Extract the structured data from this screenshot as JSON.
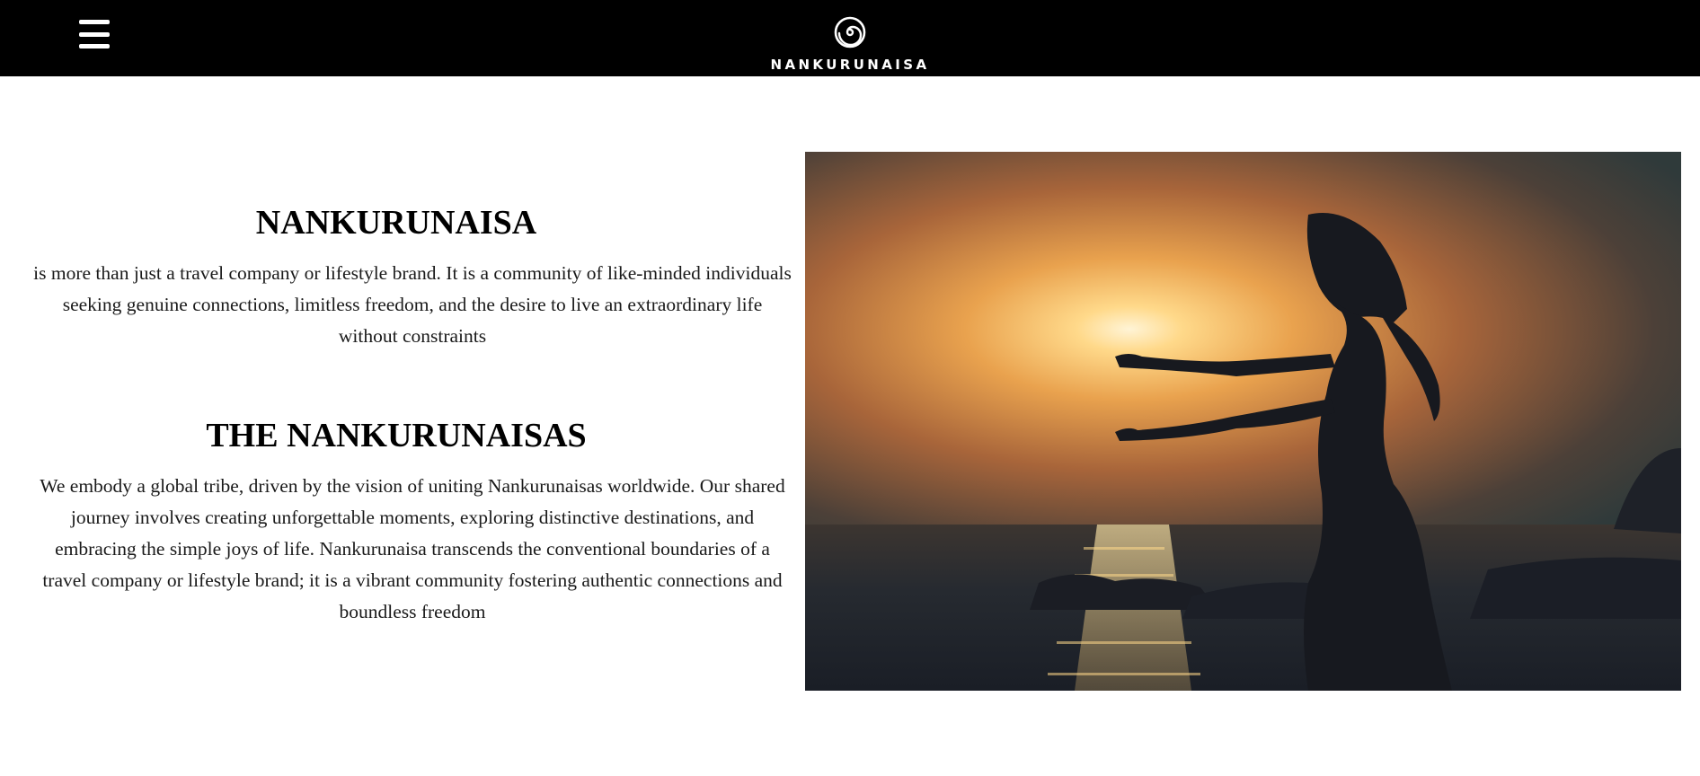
{
  "header": {
    "menu_icon": "hamburger-menu-icon",
    "logo_icon": "spiral-icon",
    "logo_text": "NANKURUNAISA",
    "background": "#000000"
  },
  "intro": {
    "title": "NANKURUNAISA",
    "body": "is more than just a travel company or lifestyle brand. It is a community of like-minded individuals seeking genuine connections, limitless freedom, and the desire to live an extraordinary life without constraints"
  },
  "tribe": {
    "title": "THE NANKURUNAISAS",
    "body": "We embody a global tribe, driven by the vision of uniting Nankurunaisas worldwide. Our shared journey involves creating unforgettable moments, exploring distinctive destinations, and embracing the simple joys of life. Nankurunaisa transcends the conventional boundaries of a travel company or lifestyle brand; it is a vibrant community fostering authentic connections and boundless freedom"
  }
}
